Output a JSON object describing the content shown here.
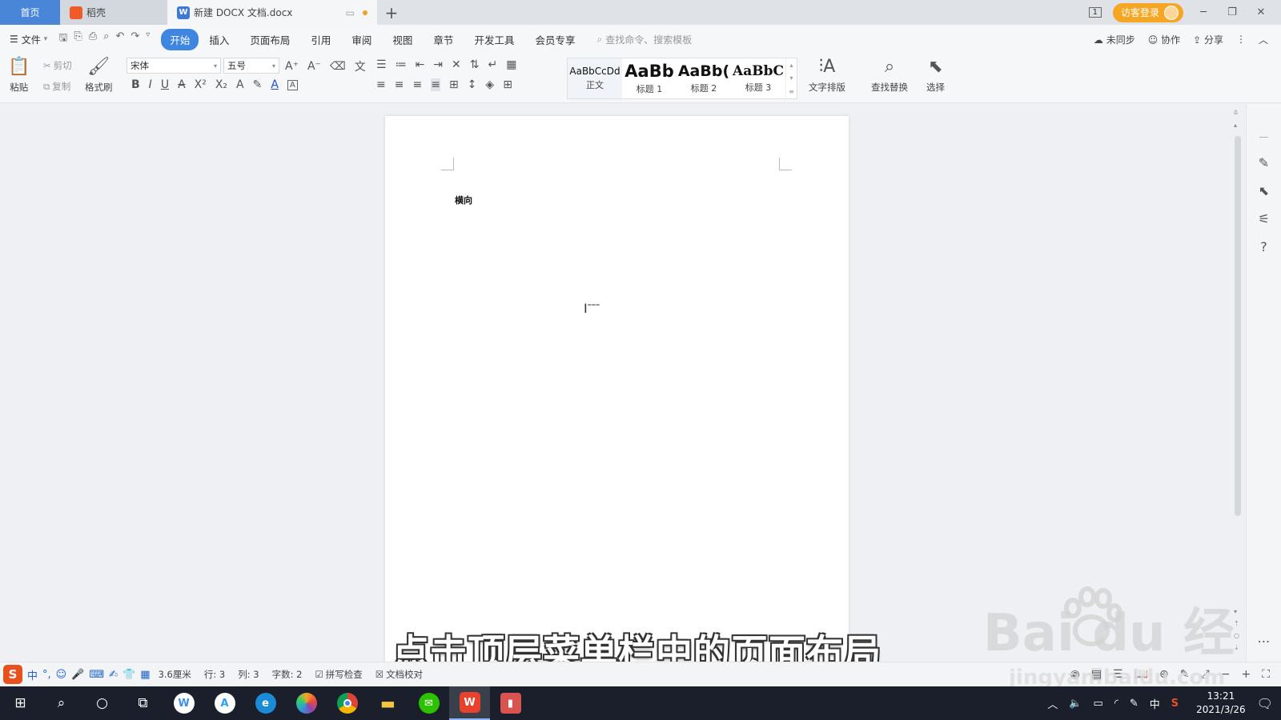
{
  "tabs": {
    "home": "首页",
    "daoke": "稻壳",
    "doc": "新建 DOCX 文档.docx",
    "add": "+"
  },
  "titlebar": {
    "login": "访客登录",
    "page_indicator": "1"
  },
  "menu": {
    "file": "文件",
    "items": [
      "开始",
      "插入",
      "页面布局",
      "引用",
      "审阅",
      "视图",
      "章节",
      "开发工具",
      "会员专享"
    ],
    "search_placeholder": "查找命令、搜索模板",
    "sync": "未同步",
    "collab": "协作",
    "share": "分享"
  },
  "ribbon": {
    "paste": "粘贴",
    "cut": "剪切",
    "copy": "复制",
    "format_painter": "格式刷",
    "font_name": "宋体",
    "font_size": "五号",
    "styles": [
      {
        "sample": "AaBbCcDd",
        "name": "正文"
      },
      {
        "sample": "AaBb",
        "name": "标题 1"
      },
      {
        "sample": "AaBb(",
        "name": "标题 2"
      },
      {
        "sample": "AaBbC",
        "name": "标题 3"
      }
    ],
    "text_layout": "文字排版",
    "find_replace": "查找替换",
    "select": "选择"
  },
  "document": {
    "text": "横向"
  },
  "caption": "点击顶层菜单栏中的页面布局",
  "watermark": {
    "brand": "Bai  du 经验",
    "url": "jingyan.baidu.com"
  },
  "statusbar": {
    "ime_label": "中",
    "position": "3.6厘米",
    "row": "行: 3",
    "col": "列: 3",
    "word_count": "字数: 2",
    "spellcheck": "拼写检查",
    "proofread": "文档校对"
  },
  "taskbar": {
    "tray_lang": "中",
    "time": "13:21",
    "date": "2021/3/26"
  },
  "colors": {
    "accent": "#3e86e0",
    "home_tab": "#4a86d8",
    "login": "#f5a623",
    "taskbar": "#1a1f2b"
  }
}
